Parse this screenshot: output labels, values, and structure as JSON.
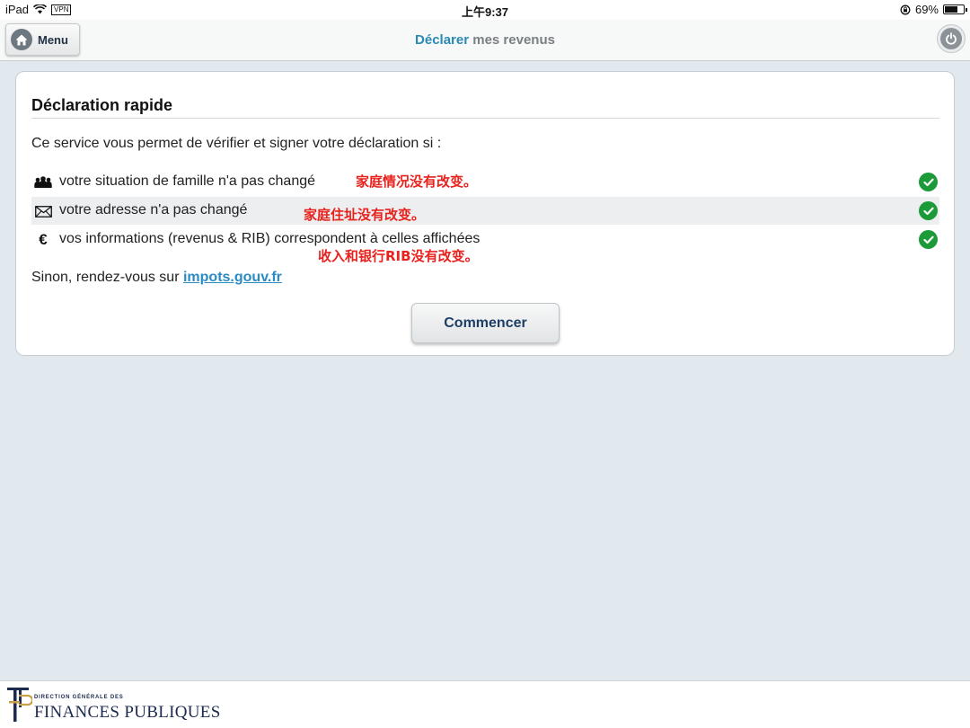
{
  "status_bar": {
    "device": "iPad",
    "vpn": "VPN",
    "time": "上午9:37",
    "battery": "69%",
    "battery_level": 0.69
  },
  "nav": {
    "menu_label": "Menu",
    "title_accent": "Déclarer",
    "title_rest": " mes revenus"
  },
  "card": {
    "title": "Déclaration rapide",
    "intro": "Ce service vous permet de vérifier et signer votre déclaration si :",
    "conditions": [
      {
        "icon": "family-icon",
        "text": "votre situation de famille n'a pas changé",
        "annotation": "家庭情况没有改变。",
        "checked": true
      },
      {
        "icon": "envelope-icon",
        "text": "votre adresse n'a pas changé",
        "annotation": "家庭住址没有改变。",
        "checked": true
      },
      {
        "icon": "euro-icon",
        "text": "vos informations (revenus & RIB) correspondent à celles affichées",
        "annotation": "收入和银行RIB没有改变。",
        "checked": true
      }
    ],
    "sinon_text": "Sinon, rendez-vous sur ",
    "sinon_link": "impots.gouv.fr",
    "start_button": "Commencer"
  },
  "footer": {
    "logo_small": "DIRECTION GÉNÉRALE DES",
    "logo_big": "FINANCES PUBLIQUES"
  },
  "colors": {
    "accent": "#2a8ab5",
    "check_green": "#1d9a38",
    "annotation_red": "#e8221d",
    "background": "#e1e8ee"
  }
}
